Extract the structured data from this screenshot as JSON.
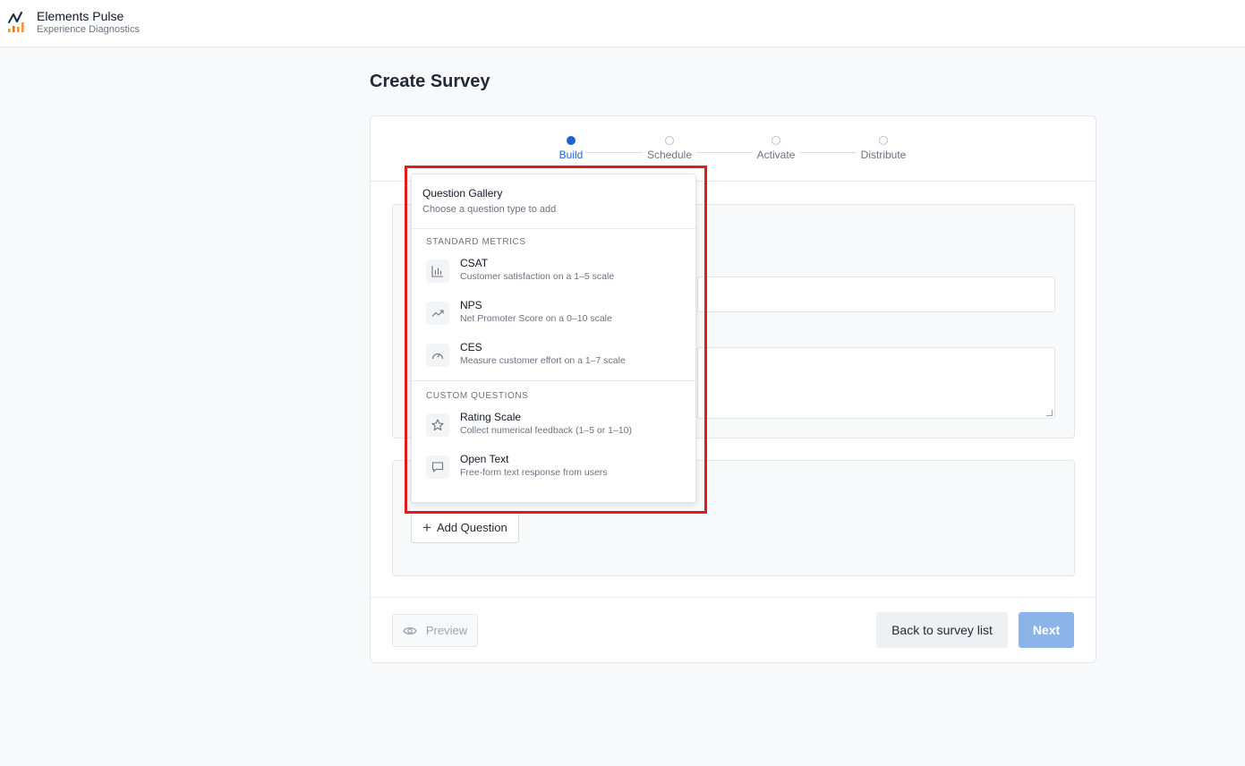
{
  "app": {
    "title": "Elements Pulse",
    "subtitle": "Experience Diagnostics",
    "logo_icon": "bar-chart-logo-icon"
  },
  "page": {
    "title": "Create Survey"
  },
  "stepper": {
    "steps": [
      {
        "label": "Build",
        "active": true
      },
      {
        "label": "Schedule",
        "active": false
      },
      {
        "label": "Activate",
        "active": false
      },
      {
        "label": "Distribute",
        "active": false
      }
    ]
  },
  "questions": {
    "add_label": "Add Question"
  },
  "footer": {
    "preview_label": "Preview",
    "back_label": "Back to survey list",
    "next_label": "Next"
  },
  "gallery": {
    "title": "Question Gallery",
    "subtitle": "Choose a question type to add",
    "groups": [
      {
        "label": "STANDARD METRICS",
        "items": [
          {
            "name": "CSAT",
            "desc": "Customer satisfaction on a 1–5 scale",
            "icon": "bar-chart-icon"
          },
          {
            "name": "NPS",
            "desc": "Net Promoter Score on a 0–10 scale",
            "icon": "trend-up-icon"
          },
          {
            "name": "CES",
            "desc": "Measure customer effort on a 1–7 scale",
            "icon": "gauge-icon"
          }
        ]
      },
      {
        "label": "CUSTOM QUESTIONS",
        "items": [
          {
            "name": "Rating Scale",
            "desc": "Collect numerical feedback (1–5 or 1–10)",
            "icon": "star-icon"
          },
          {
            "name": "Open Text",
            "desc": "Free-form text response from users",
            "icon": "chat-bubble-icon"
          }
        ]
      }
    ]
  },
  "colors": {
    "accent": "#1d63d6",
    "next_disabled": "#8db4ea",
    "highlight": "#e01b1b"
  }
}
